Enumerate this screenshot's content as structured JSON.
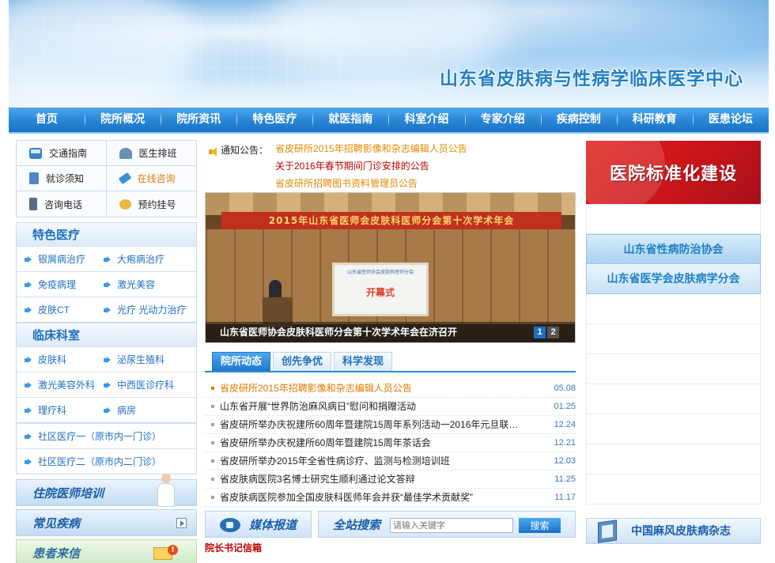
{
  "site_title": "山东省皮肤病与性病学临床医学中心",
  "nav": [
    "首页",
    "院所概况",
    "院所资讯",
    "特色医疗",
    "就医指南",
    "科室介绍",
    "专家介绍",
    "疾病控制",
    "科研教育",
    "医患论坛"
  ],
  "quick_links": [
    {
      "label": "交通指南",
      "icon": "bus-icon"
    },
    {
      "label": "医生排班",
      "icon": "doctor-icon"
    },
    {
      "label": "就诊须知",
      "icon": "clipboard-icon"
    },
    {
      "label": "在线咨询",
      "icon": "tag-icon",
      "highlight": true
    },
    {
      "label": "咨询电话",
      "icon": "phone-icon"
    },
    {
      "label": "预约挂号",
      "icon": "chat-bubble-icon"
    }
  ],
  "special_medical": {
    "title": "特色医疗",
    "items": [
      "银屑病治疗",
      "大疱病治疗",
      "免疫病理",
      "激光美容",
      "皮肤CT",
      "光疗 光动力治疗"
    ]
  },
  "clinical_depts": {
    "title": "临床科室",
    "grid_items": [
      "皮肤科",
      "泌尿生殖科",
      "激光美容外科",
      "中西医诊疗科",
      "理疗科",
      "病房"
    ],
    "list_items": [
      "社区医疗一（原市内一门诊）",
      "社区医疗二（原市内二门诊）"
    ]
  },
  "side_buttons": {
    "training": "住院医师培训",
    "common_diseases": "常见疾病",
    "patient_letters": "患者来信"
  },
  "notice": {
    "label": "通知公告：",
    "items": [
      {
        "text": "省皮研所2015年招聘影像和杂志编辑人员公告",
        "color": "#e08a00"
      },
      {
        "text": "关于2016年春节期间门诊安排的公告",
        "color": "#c00000"
      },
      {
        "text": "省皮研所招聘图书资料管理员公告",
        "color": "#e08a00"
      }
    ]
  },
  "slideshow": {
    "banner_text": "2015年山东省医师会皮肤科医师分会第十次学术年会",
    "screen_title": "山东省医师协会皮肤科医师分会",
    "screen_main": "开幕式",
    "caption": "山东省医师协会皮肤科医师分会第十次学术年会在济召开",
    "pages": [
      "1",
      "2"
    ]
  },
  "tabs": [
    "院所动态",
    "创先争优",
    "科学发现"
  ],
  "news": [
    {
      "title": "省皮研所2015年招聘影像和杂志编辑人员公告",
      "date": "05.08",
      "highlight": true
    },
    {
      "title": "山东省开展“世界防治麻风病日”慰问和捐赠活动",
      "date": "01.25"
    },
    {
      "title": "省皮研所举办庆祝建所60周年暨建院15周年系列活动一2016年元旦联…",
      "date": "12.24"
    },
    {
      "title": "省皮研所举办庆祝建所60周年暨建院15周年茶话会",
      "date": "12.21"
    },
    {
      "title": "省皮研所举办2015年全省性病诊疗、监测与检测培训班",
      "date": "12.03"
    },
    {
      "title": "省皮肤病医院3名博士研究生顺利通过论文答辩",
      "date": "11.25"
    },
    {
      "title": "省皮肤病医院参加全国皮肤科医师年会并获“最佳学术贡献奖”",
      "date": "11.17"
    }
  ],
  "media": "媒体报道",
  "search": {
    "label": "全站搜索",
    "placeholder": "请输入关键字",
    "button": "搜索"
  },
  "secretary_link": "院长书记信箱",
  "right": {
    "standard_banner": "医院标准化建设",
    "assoc_std": "山东省性病防治协会",
    "assoc_derm": "山东省医学会皮肤病学分会",
    "journal": "中国麻风皮肤病杂志"
  }
}
